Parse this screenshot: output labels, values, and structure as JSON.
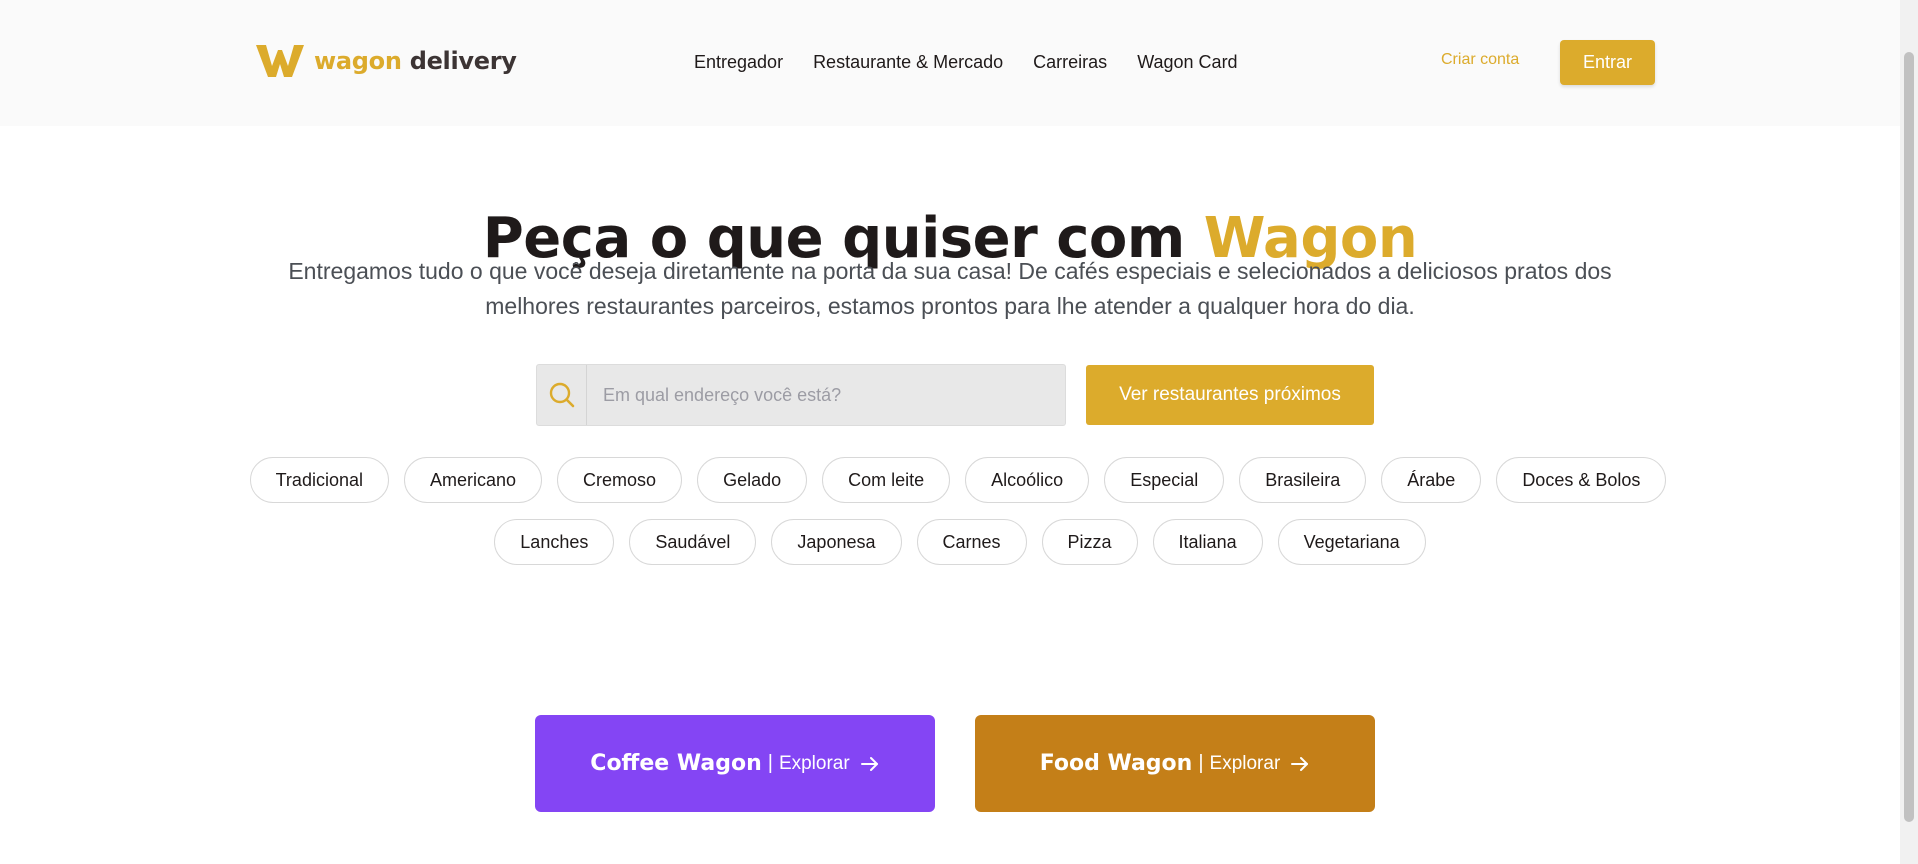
{
  "brand": {
    "name_part1": "wagon",
    "name_part2": "delivery",
    "accent_color": "#dcab2c",
    "dark_color": "#3c3434"
  },
  "nav": {
    "items": [
      "Entregador",
      "Restaurante & Mercado",
      "Carreiras",
      "Wagon Card"
    ]
  },
  "auth": {
    "signup_label": "Criar conta",
    "login_label": "Entrar"
  },
  "hero": {
    "title_main": "Peça o que quiser com",
    "title_accent": "Wagon",
    "subtitle": "Entregamos tudo o que você deseja diretamente na porta da sua casa! De cafés especiais e selecionados a deliciosos pratos dos melhores restaurantes parceiros, estamos prontos para lhe atender a qualquer hora do dia."
  },
  "search": {
    "placeholder": "Em qual endereço você está?",
    "button_label": "Ver restaurantes próximos",
    "icon": "search-icon"
  },
  "categories": {
    "row1": [
      "Tradicional",
      "Americano",
      "Cremoso",
      "Gelado",
      "Com leite",
      "Alcoólico",
      "Especial",
      "Brasileira",
      "Árabe",
      "Doces & Bolos"
    ],
    "row2": [
      "Lanches",
      "Saudável",
      "Japonesa",
      "Carnes",
      "Pizza",
      "Italiana",
      "Vegetariana"
    ]
  },
  "cta": {
    "coffee": {
      "title": "Coffee Wagon",
      "separator": "|",
      "action": "Explorar",
      "color": "#8445f4",
      "icon": "arrow-right-icon"
    },
    "food": {
      "title": "Food Wagon",
      "separator": "|",
      "action": "Explorar",
      "color": "#c47f18",
      "icon": "arrow-right-icon"
    }
  }
}
